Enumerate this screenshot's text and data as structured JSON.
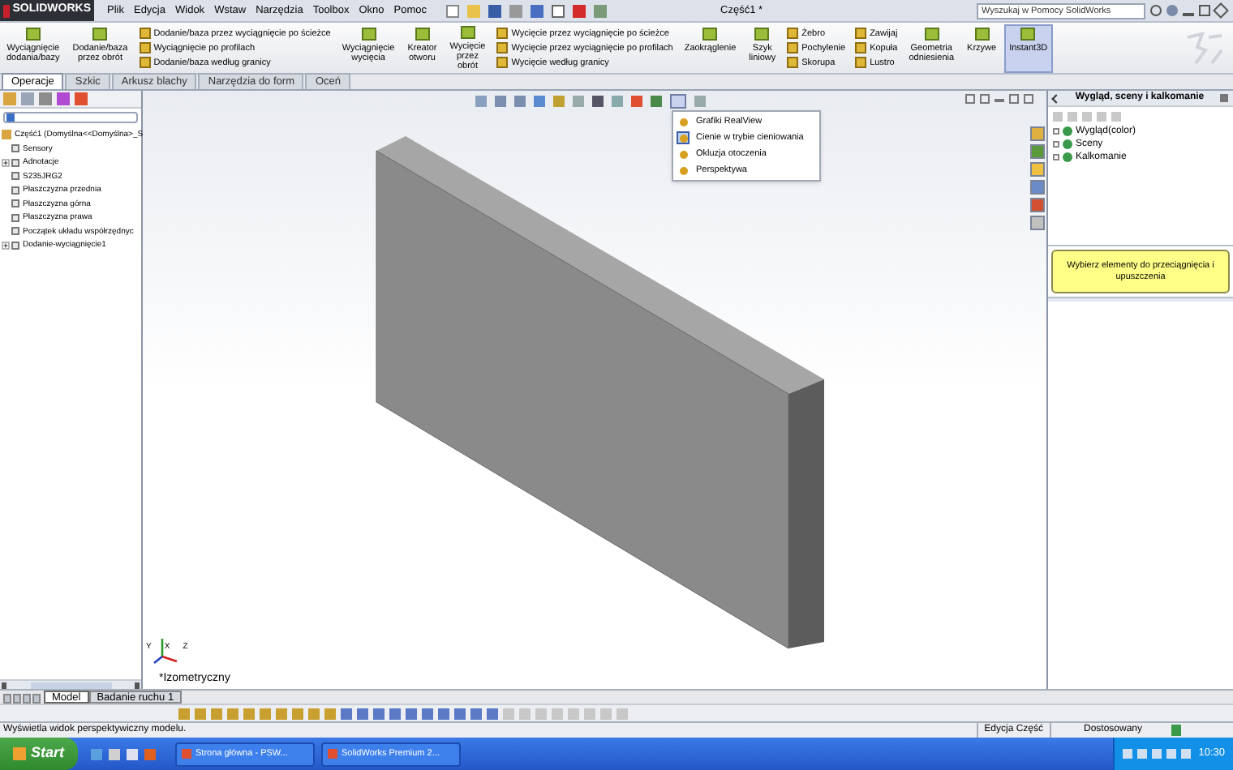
{
  "app": {
    "logo": "SOLIDWORKS",
    "title": "Część1 *"
  },
  "menu": [
    "Plik",
    "Edycja",
    "Widok",
    "Wstaw",
    "Narzędzia",
    "Toolbox",
    "Okno",
    "Pomoc"
  ],
  "search": {
    "placeholder": "Wyszukaj w Pomocy SolidWorks"
  },
  "ribbon": [
    {
      "kind": "big",
      "label": "Wyciągnięcie\ndodania/bazy",
      "selected": false
    },
    {
      "kind": "big",
      "label": "Dodanie/baza\nprzez obrót",
      "selected": false
    },
    {
      "kind": "stack",
      "items": [
        "Dodanie/baza przez wyciągnięcie po ścieżce",
        "Wyciągnięcie po profilach",
        "Dodanie/baza według granicy"
      ]
    },
    {
      "kind": "big",
      "label": "Wyciągnięcie\nwycięcia",
      "selected": false
    },
    {
      "kind": "big",
      "label": "Kreator\notworu",
      "selected": false
    },
    {
      "kind": "big",
      "label": "Wycięcie\nprzez\nobrót",
      "selected": false
    },
    {
      "kind": "stack",
      "items": [
        "Wycięcie przez wyciągnięcie po ścieżce",
        "Wycięcie przez wyciągnięcie po profilach",
        "Wycięcie według granicy"
      ]
    },
    {
      "kind": "big",
      "label": "Zaokrąglenie",
      "selected": false
    },
    {
      "kind": "big",
      "label": "Szyk\nliniowy",
      "selected": false
    },
    {
      "kind": "stack",
      "items": [
        "Żebro",
        "Pochylenie",
        "Skorupa"
      ]
    },
    {
      "kind": "stack",
      "items": [
        "Zawijaj",
        "Kopuła",
        "Lustro"
      ]
    },
    {
      "kind": "big",
      "label": "Geometria\nodniesienia",
      "selected": false
    },
    {
      "kind": "big",
      "label": "Krzywe",
      "selected": false
    },
    {
      "kind": "big",
      "label": "Instant3D",
      "selected": true
    }
  ],
  "tabs": [
    {
      "label": "Operacje",
      "selected": true
    },
    {
      "label": "Szkic",
      "selected": false
    },
    {
      "label": "Arkusz blachy",
      "selected": false
    },
    {
      "label": "Narzędzia do form",
      "selected": false
    },
    {
      "label": "Oceń",
      "selected": false
    }
  ],
  "tree": {
    "root": "Część1  (Domyślna<<Domyślna>_S",
    "items": [
      {
        "label": "Sensory"
      },
      {
        "label": "Adnotacje",
        "expanded": false
      },
      {
        "label": "S235JRG2"
      },
      {
        "label": "Płaszczyzna przednia"
      },
      {
        "label": "Płaszczyzna górna"
      },
      {
        "label": "Płaszczyzna prawa"
      },
      {
        "label": "Początek układu współrzędnyc"
      },
      {
        "label": "Dodanie-wyciągnięcie1",
        "expanded": false
      }
    ]
  },
  "viewport": {
    "view_label": "*Izometryczny",
    "triad": [
      "Y",
      "X",
      "Z"
    ],
    "menu": [
      {
        "label": "Grafiki RealView",
        "on": false
      },
      {
        "label": "Cienie w trybie cieniowania",
        "on": true
      },
      {
        "label": "Okluzja otoczenia",
        "on": false
      },
      {
        "label": "Perspektywa",
        "on": false
      }
    ]
  },
  "task_pane": {
    "title": "Wygląd, sceny i kalkomanie",
    "items": [
      "Wygląd(color)",
      "Sceny",
      "Kalkomanie"
    ],
    "note": "Wybierz elementy do przeciągnięcia i upuszczenia"
  },
  "model_tabs": [
    {
      "label": "Model",
      "selected": true
    },
    {
      "label": "Badanie ruchu 1",
      "selected": false
    }
  ],
  "status_bar": {
    "message": "Wyświetla widok perspektywiczny modelu.",
    "mode": "Edycja Część",
    "units": "Dostosowany"
  },
  "taskbar": {
    "start": "Start",
    "tasks": [
      "Strona główna - PSW...",
      "SolidWorks Premium 2..."
    ],
    "clock": "10:30"
  }
}
